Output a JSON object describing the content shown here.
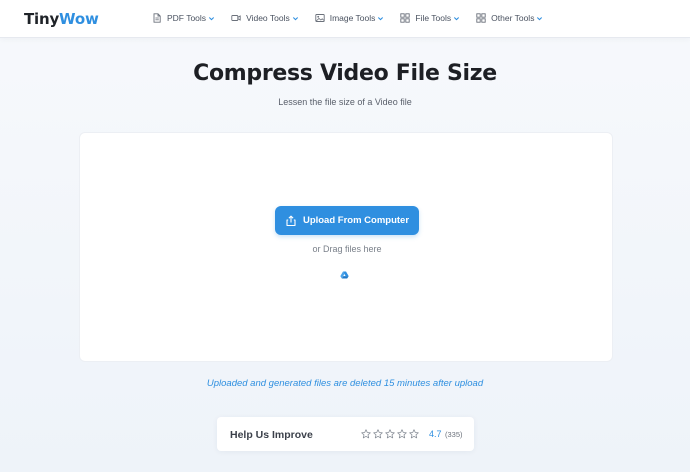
{
  "brand": {
    "part1": "Tiny",
    "part2": "Wow",
    "accent_color": "#2f8fe0"
  },
  "nav": {
    "items": [
      {
        "label": "PDF Tools",
        "icon": "document-icon"
      },
      {
        "label": "Video Tools",
        "icon": "video-camera-icon"
      },
      {
        "label": "Image Tools",
        "icon": "image-icon"
      },
      {
        "label": "File Tools",
        "icon": "grid-icon"
      },
      {
        "label": "Other Tools",
        "icon": "grid-icon"
      }
    ]
  },
  "page": {
    "title": "Compress Video File Size",
    "subtitle": "Lessen the file size of a Video file"
  },
  "upload": {
    "button_label": "Upload From Computer",
    "button_icon": "upload-icon",
    "drag_text": "or Drag files here",
    "drive_icon": "google-drive-icon"
  },
  "notice": "Uploaded and generated files are deleted 15 minutes after upload",
  "rating": {
    "title": "Help Us Improve",
    "stars_total": 5,
    "score": "4.7",
    "count": "(335)"
  }
}
